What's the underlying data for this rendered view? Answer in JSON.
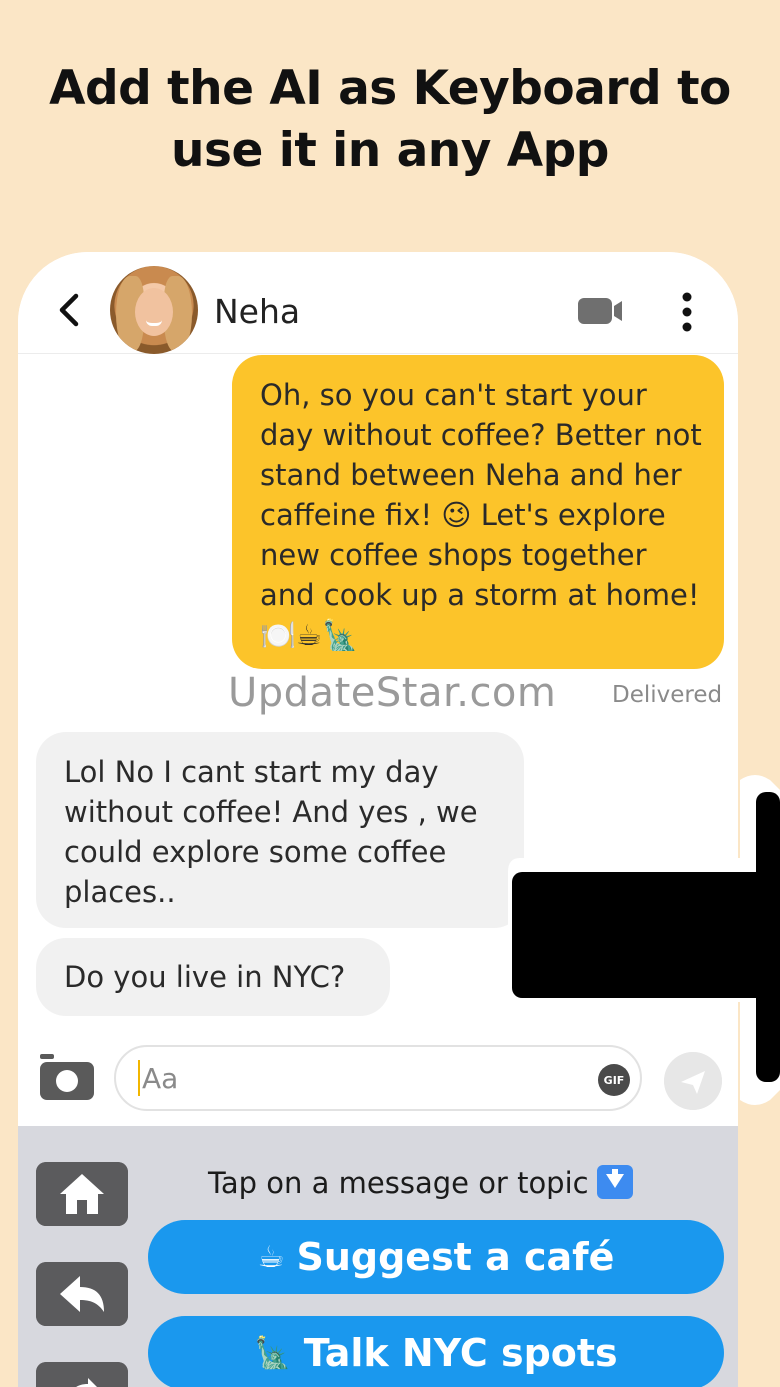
{
  "headline": {
    "line1": "Add the AI as Keyboard to",
    "line2": "use it in any App"
  },
  "chat": {
    "contact_name": "Neha",
    "messages": [
      {
        "direction": "outgoing",
        "text": "Oh, so you can't start your day without coffee? Better not stand between Neha and her caffeine fix! 😉 Let's explore new coffee shops together and cook up a storm at home! 🍽️☕🗽",
        "status": "Delivered"
      },
      {
        "direction": "incoming",
        "text": "Lol No I cant start my day without coffee! And yes , we could explore some coffee places.."
      },
      {
        "direction": "incoming",
        "text": "Do you live in NYC?"
      }
    ],
    "input_placeholder": "Aa",
    "gif_label": "GIF"
  },
  "watermark": "UpdateStar.com",
  "keyboard": {
    "prompt": "Tap on a message or topic",
    "suggestions": [
      {
        "emoji": "☕",
        "label": "Suggest a café"
      },
      {
        "emoji": "🗽",
        "label": "Talk NYC spots"
      }
    ]
  },
  "colors": {
    "background": "#fbe6c6",
    "outgoing_bubble": "#fcc42a",
    "incoming_bubble": "#f1f1f1",
    "suggestion_button": "#1a98ee",
    "keyboard_bg": "#d7d8de"
  },
  "icons": [
    "back-arrow-icon",
    "video-camera-icon",
    "more-vertical-icon",
    "camera-icon",
    "gif-icon",
    "send-icon",
    "home-icon",
    "reply-icon",
    "forward-icon",
    "down-arrow-icon"
  ]
}
